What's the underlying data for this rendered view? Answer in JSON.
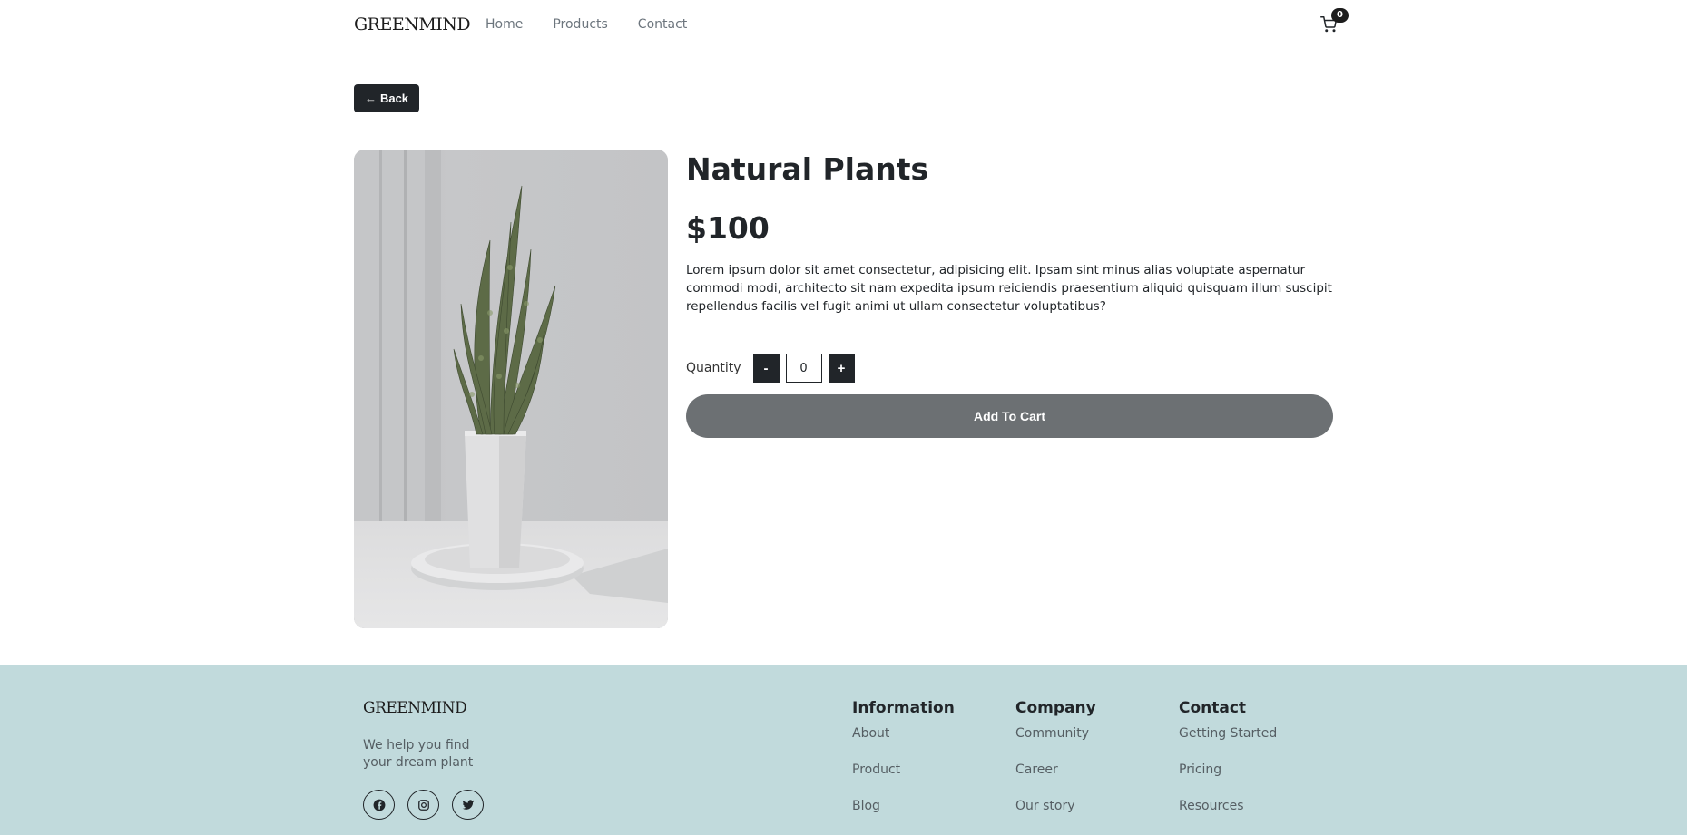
{
  "nav": {
    "logo": "GREENMIND",
    "links": [
      "Home",
      "Products",
      "Contact"
    ],
    "cart_count": "0"
  },
  "back_label": "Back",
  "product": {
    "image_alt": "Snake plant in white pot",
    "title": "Natural Plants",
    "price": "$100",
    "description": "Lorem ipsum dolor sit amet consectetur, adipisicing elit. Ipsam sint minus alias voluptate aspernatur commodi modi, architecto sit nam expedita ipsum reiciendis praesentium aliquid quisquam illum suscipit repellendus facilis vel fugit animi ut ullam consectetur voluptatibus?",
    "quantity_label": "Quantity",
    "decrement_label": "-",
    "increment_label": "+",
    "quantity_value": "0",
    "add_to_cart_label": "Add To Cart"
  },
  "footer": {
    "logo": "GREENMIND",
    "tagline": "We help you find your dream plant",
    "socials": [
      "facebook-icon",
      "instagram-icon",
      "twitter-icon"
    ],
    "columns": [
      {
        "heading": "Information",
        "links": [
          "About",
          "Product",
          "Blog"
        ]
      },
      {
        "heading": "Company",
        "links": [
          "Community",
          "Career",
          "Our story"
        ]
      },
      {
        "heading": "Contact",
        "links": [
          "Getting Started",
          "Pricing",
          "Resources"
        ]
      }
    ]
  },
  "colors": {
    "dark": "#212529",
    "footer_bg": "#c1dadc",
    "button_gray": "#6c7073",
    "muted_text": "#6c757d"
  }
}
